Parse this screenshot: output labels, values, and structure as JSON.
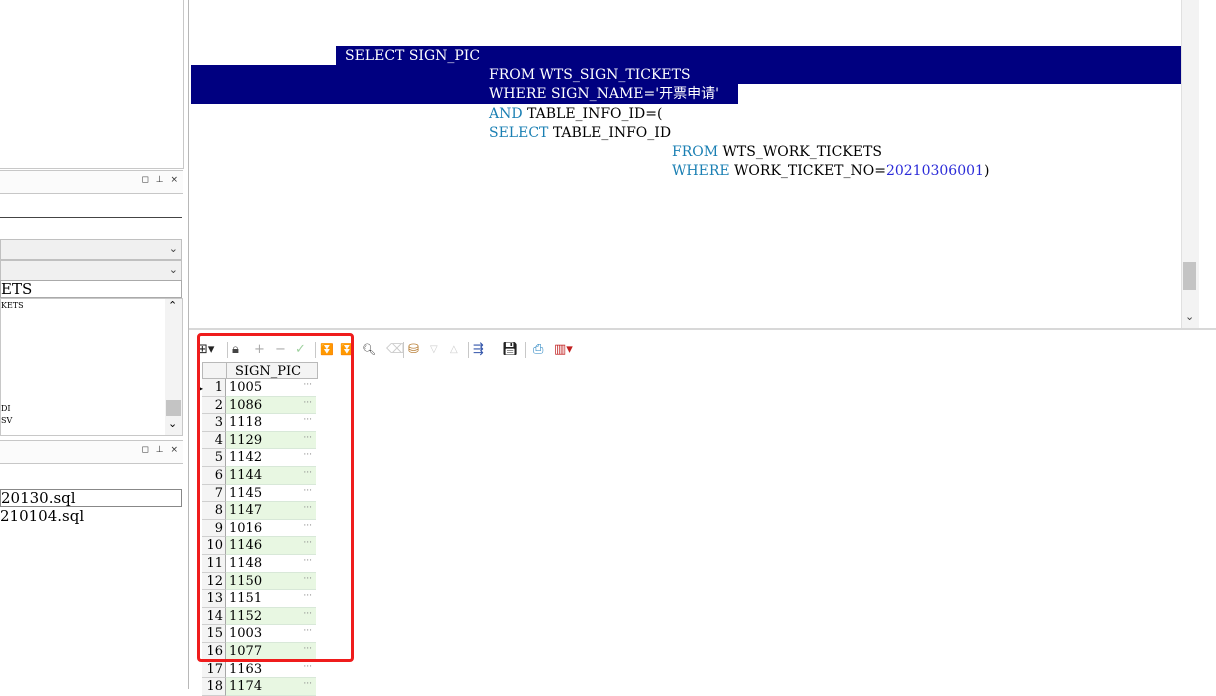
{
  "left_panel": {
    "object_text": "ETS",
    "list_items": [
      "KETS",
      "DI",
      "SV"
    ],
    "files": [
      "20130.sql",
      "210104.sql"
    ]
  },
  "editor": {
    "lines": [
      {
        "parts": [
          {
            "t": "SELECT SIGN_PIC",
            "c": "sel"
          }
        ]
      },
      {
        "parts": [
          {
            "t": "FROM WTS_SIGN_TICKETS",
            "c": "sel"
          }
        ]
      },
      {
        "parts": [
          {
            "t": "WHERE SIGN_NAME='开票申请'",
            "c": "sel"
          }
        ]
      },
      {
        "parts": [
          {
            "t": "AND ",
            "c": "kw"
          },
          {
            "t": "TABLE_INFO_ID=(",
            "c": "plain"
          }
        ]
      },
      {
        "parts": [
          {
            "t": "SELECT ",
            "c": "kw"
          },
          {
            "t": "TABLE_INFO_ID",
            "c": "plain"
          }
        ]
      },
      {
        "parts": [
          {
            "t": "FROM ",
            "c": "kw"
          },
          {
            "t": "WTS_WORK_TICKETS",
            "c": "plain"
          }
        ]
      },
      {
        "parts": [
          {
            "t": "WHERE ",
            "c": "kw"
          },
          {
            "t": "WORK_TICKET_NO=",
            "c": "plain"
          },
          {
            "t": "20210306001",
            "c": "num"
          },
          {
            "t": ")",
            "c": "plain"
          }
        ]
      }
    ]
  },
  "toolbar": {
    "icons": [
      "grid-icon",
      "lock-icon",
      "add-record-icon",
      "delete-record-icon",
      "post-icon",
      "fetch-next-icon",
      "fetch-last-icon",
      "find-icon",
      "clear-icon",
      "query-by-example-icon",
      "filter-down-icon",
      "filter-up-icon",
      "export-icon",
      "save-icon",
      "print-icon",
      "chart-icon"
    ]
  },
  "grid": {
    "column_header": "SIGN_PIC",
    "rows": [
      {
        "n": "1",
        "v": "1005"
      },
      {
        "n": "2",
        "v": "1086"
      },
      {
        "n": "3",
        "v": "1118"
      },
      {
        "n": "4",
        "v": "1129"
      },
      {
        "n": "5",
        "v": "1142"
      },
      {
        "n": "6",
        "v": "1144"
      },
      {
        "n": "7",
        "v": "1145"
      },
      {
        "n": "8",
        "v": "1147"
      },
      {
        "n": "9",
        "v": "1016"
      },
      {
        "n": "10",
        "v": "1146"
      },
      {
        "n": "11",
        "v": "1148"
      },
      {
        "n": "12",
        "v": "1150"
      },
      {
        "n": "13",
        "v": "1151"
      },
      {
        "n": "14",
        "v": "1152"
      },
      {
        "n": "15",
        "v": "1003"
      },
      {
        "n": "16",
        "v": "1077"
      },
      {
        "n": "17",
        "v": "1163"
      },
      {
        "n": "18",
        "v": "1174"
      }
    ],
    "cell_ellipsis": "···"
  },
  "colors": {
    "selection": "#000080",
    "keyword": "#1a7fb3",
    "number": "#2b2bd8",
    "highlight_box": "#ef1c1c",
    "even_row": "#e8f7e2"
  }
}
